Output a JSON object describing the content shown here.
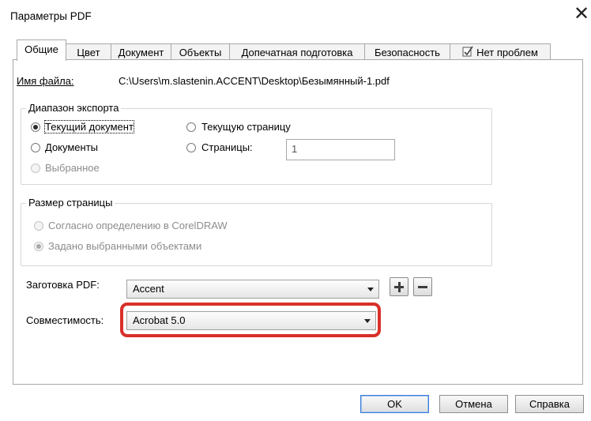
{
  "window": {
    "title": "Параметры PDF",
    "close_glyph": "✕"
  },
  "tabs": [
    {
      "label": "Общие"
    },
    {
      "label": "Цвет"
    },
    {
      "label": "Документ"
    },
    {
      "label": "Объекты"
    },
    {
      "label": "Допечатная подготовка"
    },
    {
      "label": "Безопасность"
    },
    {
      "label": "Нет проблем",
      "icon": "checklist-icon"
    }
  ],
  "file": {
    "label": "Имя файла:",
    "value": "C:\\Users\\m.slastenin.ACCENT\\Desktop\\Безымянный-1.pdf"
  },
  "export_range": {
    "title": "Диапазон экспорта",
    "current_document": "Текущий документ",
    "documents": "Документы",
    "selected": "Выбранное",
    "current_page": "Текущую страницу",
    "pages": "Страницы:",
    "pages_value": "1"
  },
  "page_size": {
    "title": "Размер страницы",
    "coreldraw": "Согласно определению в CorelDRAW",
    "selected_objects": "Задано выбранными объектами"
  },
  "preset": {
    "label": "Заготовка PDF:",
    "value": "Accent"
  },
  "compat": {
    "label": "Совместимость:",
    "value": "Acrobat 5.0"
  },
  "buttons": {
    "ok": "OK",
    "cancel": "Отмена",
    "help": "Справка"
  },
  "colors": {
    "highlight": "#d9302a",
    "default_button_border": "#3d7bd4"
  }
}
